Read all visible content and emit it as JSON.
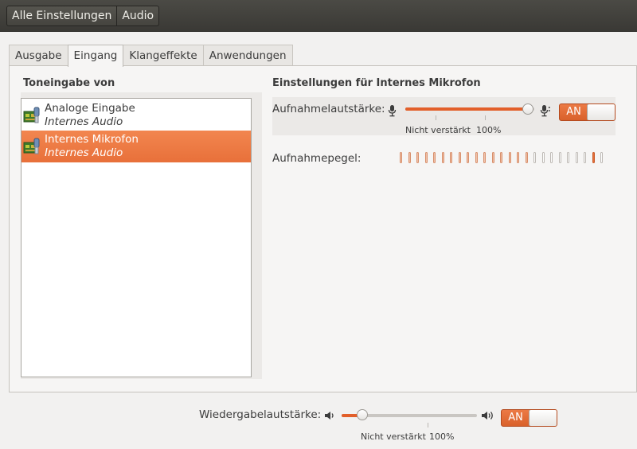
{
  "header": {
    "breadcrumb": [
      "Alle Einstellungen",
      "Audio"
    ]
  },
  "tabs": [
    {
      "label": "Ausgabe",
      "active": false
    },
    {
      "label": "Eingang",
      "active": true
    },
    {
      "label": "Klangeffekte",
      "active": false
    },
    {
      "label": "Anwendungen",
      "active": false
    }
  ],
  "input_source": {
    "title": "Toneingabe von",
    "devices": [
      {
        "name": "Analoge Eingabe",
        "subtitle": "Internes Audio",
        "selected": false
      },
      {
        "name": "Internes Mikrofon",
        "subtitle": "Internes Audio",
        "selected": true
      }
    ]
  },
  "settings": {
    "title": "Einstellungen für Internes Mikrofon",
    "volume_label": "Aufnahmelautstärke:",
    "volume_level": 0.95,
    "mark_unamplified": "Nicht verstärkt",
    "mark_100": "100%",
    "switch_label": "AN",
    "level_label": "Aufnahmepegel:",
    "level_total": 25,
    "level_lit": 16
  },
  "output_volume": {
    "label": "Wiedergabelautstärke:",
    "level": 0.15,
    "mark_unamplified": "Nicht verstärkt",
    "mark_100": "100%",
    "switch_label": "AN"
  },
  "colors": {
    "accent": "#e8703a",
    "toolbar": "#3d3c38"
  },
  "icons": {
    "device": "sound-card-icon",
    "mic_low": "microphone-low-icon",
    "mic_high": "microphone-high-icon",
    "speaker_low": "speaker-low-icon",
    "speaker_high": "speaker-high-icon"
  }
}
